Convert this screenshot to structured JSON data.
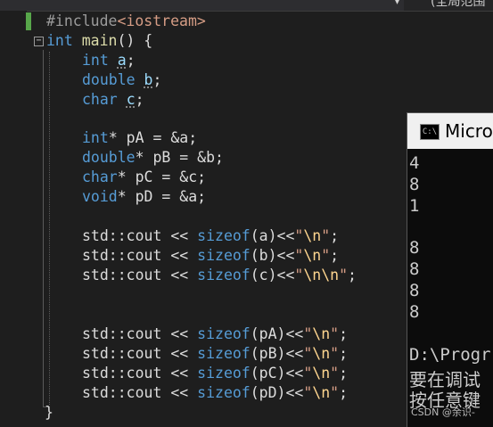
{
  "topbar": {
    "scope_text": "(全局范围",
    "dropdown_arrow": "▾"
  },
  "editor": {
    "collapse_glyph": "−",
    "line1": {
      "directive": "#include",
      "file": "<iostream>"
    },
    "line2": {
      "kw": "int",
      "fn": "main",
      "rest": "() {"
    },
    "decl_a": {
      "type": "int",
      "name": "a",
      "end": ";"
    },
    "decl_b": {
      "type": "double",
      "name": "b",
      "end": ";"
    },
    "decl_c": {
      "type": "char",
      "name": "c",
      "end": ";"
    },
    "ptr_a": {
      "type": "int",
      "rest": "* pA = &a;"
    },
    "ptr_b": {
      "type": "double",
      "rest": "* pB = &b;"
    },
    "ptr_c": {
      "type": "char",
      "rest": "* pC = &c;"
    },
    "ptr_d": {
      "type": "void",
      "rest": "* pD = &a;"
    },
    "cout_a": {
      "pre": "std::cout << ",
      "fn": "sizeof",
      "arg": "(a)<<",
      "q1": "\"",
      "esc": "\\n",
      "q2": "\"",
      "end": ";"
    },
    "cout_b": {
      "pre": "std::cout << ",
      "fn": "sizeof",
      "arg": "(b)<<",
      "q1": "\"",
      "esc": "\\n",
      "q2": "\"",
      "end": ";"
    },
    "cout_c": {
      "pre": "std::cout << ",
      "fn": "sizeof",
      "arg": "(c)<<",
      "q1": "\"",
      "esc": "\\n\\n",
      "q2": "\"",
      "end": ";"
    },
    "cout_pa": {
      "pre": "std::cout << ",
      "fn": "sizeof",
      "arg": "(pA)<<",
      "q1": "\"",
      "esc": "\\n",
      "q2": "\"",
      "end": ";"
    },
    "cout_pb": {
      "pre": "std::cout << ",
      "fn": "sizeof",
      "arg": "(pB)<<",
      "q1": "\"",
      "esc": "\\n",
      "q2": "\"",
      "end": ";"
    },
    "cout_pc": {
      "pre": "std::cout << ",
      "fn": "sizeof",
      "arg": "(pC)<<",
      "q1": "\"",
      "esc": "\\n",
      "q2": "\"",
      "end": ";"
    },
    "cout_pd": {
      "pre": "std::cout << ",
      "fn": "sizeof",
      "arg": "(pD)<<",
      "q1": "\"",
      "esc": "\\n",
      "q2": "\"",
      "end": ";"
    },
    "close_brace": "}"
  },
  "console": {
    "icon_text": "C:\\",
    "title": "Micros",
    "output": [
      "4",
      "8",
      "1",
      "8",
      "8",
      "8",
      "8"
    ],
    "path_line": "D:\\Progr",
    "msg1": "要在调试",
    "msg2": "按任意键"
  },
  "watermark": "CSDN @余识-"
}
